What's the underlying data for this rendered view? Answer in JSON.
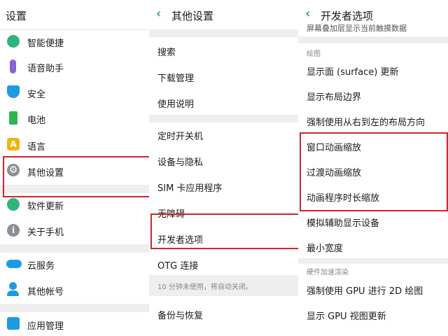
{
  "panel1": {
    "title": "设置",
    "items": [
      {
        "label": "智能便捷",
        "icon": "smart-assist-icon",
        "color": "#2fb57a"
      },
      {
        "label": "语音助手",
        "icon": "microphone-icon",
        "color": "#8a63d2"
      },
      {
        "label": "安全",
        "icon": "shield-icon",
        "color": "#1e9be0"
      },
      {
        "label": "电池",
        "icon": "battery-icon",
        "color": "#2fb54d"
      },
      {
        "label": "语言",
        "icon": "language-icon",
        "color": "#f2b213"
      },
      {
        "label": "其他设置",
        "icon": "gear-icon",
        "color": "#8a8f96"
      },
      {
        "label": "软件更新",
        "icon": "update-icon",
        "color": "#2fb57a"
      },
      {
        "label": "关于手机",
        "icon": "info-icon",
        "color": "#8a8f96"
      },
      {
        "label": "云服务",
        "icon": "cloud-icon",
        "color": "#1e9be0"
      },
      {
        "label": "其他帐号",
        "icon": "account-icon",
        "color": "#1e9be0"
      },
      {
        "label": "应用管理",
        "icon": "apps-icon",
        "color": "#1e9be0"
      }
    ]
  },
  "panel2": {
    "title": "其他设置",
    "back": "‹",
    "items": [
      {
        "label": "搜索"
      },
      {
        "label": "下载管理"
      },
      {
        "label": "使用说明"
      },
      {
        "label": "定时开关机"
      },
      {
        "label": "设备与隐私"
      },
      {
        "label": "SIM 卡应用程序"
      },
      {
        "label": "无障碍"
      },
      {
        "label": "开发者选项"
      },
      {
        "label": "OTG 连接"
      },
      {
        "label": "备份与恢复"
      }
    ],
    "otg_note": "10 分钟未使用，将自动关闭。"
  },
  "panel3": {
    "title": "开发者选项",
    "back": "‹",
    "cut_text": "屏幕叠加层显示当前触摸数据",
    "section_drawing": "绘图",
    "drawing_items": [
      {
        "label": "显示面 (surface) 更新"
      },
      {
        "label": "显示布局边界"
      },
      {
        "label": "强制使用从右到左的布局方向"
      },
      {
        "label": "窗口动画缩放"
      },
      {
        "label": "过渡动画缩放"
      },
      {
        "label": "动画程序时长缩放"
      },
      {
        "label": "模拟辅助显示设备"
      },
      {
        "label": "最小宽度"
      }
    ],
    "section_hw": "硬件加速渲染",
    "hw_items": [
      {
        "label": "强制使用 GPU 进行 2D 绘图"
      },
      {
        "label": "显示 GPU 视图更新"
      }
    ]
  },
  "highlight_color": "#d0242b"
}
